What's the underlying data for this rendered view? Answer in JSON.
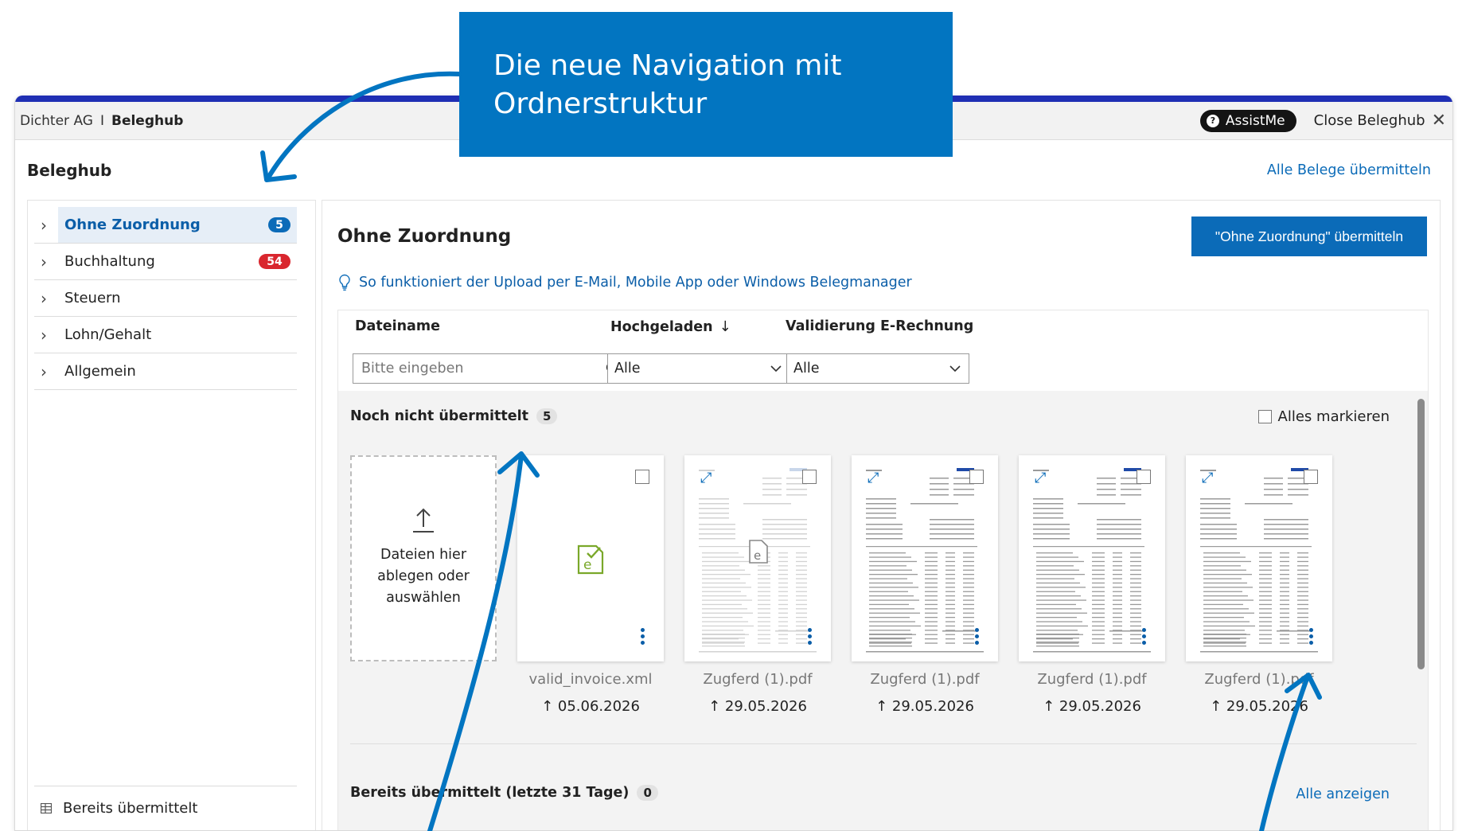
{
  "callout": {
    "line1": "Die neue Navigation mit",
    "line2": "Ordnerstruktur"
  },
  "titlebar": {
    "company": "Dichter AG",
    "separator": "I",
    "app": "Beleghub",
    "assist_label": "AssistMe",
    "close_label": "Close Beleghub"
  },
  "page": {
    "title": "Beleghub",
    "send_all_link": "Alle Belege übermitteln"
  },
  "sidebar": {
    "items": [
      {
        "label": "Ohne Zuordnung",
        "badge": "5",
        "active": true
      },
      {
        "label": "Buchhaltung",
        "badge": "54"
      },
      {
        "label": "Steuern"
      },
      {
        "label": "Lohn/Gehalt"
      },
      {
        "label": "Allgemein"
      }
    ],
    "footer_label": "Bereits übermittelt"
  },
  "main": {
    "title": "Ohne Zuordnung",
    "primary_button": "\"Ohne Zuordnung\" übermitteln",
    "info_link": "So funktioniert der Upload per E-Mail, Mobile App oder Windows Belegmanager",
    "columns": {
      "filename": "Dateiname",
      "uploaded": "Hochgeladen",
      "validation": "Validierung E-Rechnung"
    },
    "search_placeholder": "Bitte eingeben",
    "uploaded_filter": "Alle",
    "validation_filter": "Alle",
    "pending_section": {
      "title": "Noch nicht übermittelt",
      "count": "5",
      "select_all": "Alles markieren"
    },
    "dropzone": {
      "line1": "Dateien hier",
      "line2": "ablegen oder",
      "line3": "auswählen"
    },
    "files": [
      {
        "name": "valid_invoice.xml",
        "date": "05.06.2026"
      },
      {
        "name": "Zugferd (1).pdf",
        "date": "29.05.2026"
      },
      {
        "name": "Zugferd (1).pdf",
        "date": "29.05.2026"
      },
      {
        "name": "Zugferd (1).pdf",
        "date": "29.05.2026"
      },
      {
        "name": "Zugferd (1).pdf",
        "date": "29.05.2026"
      }
    ],
    "sent_section": {
      "title": "Bereits übermittelt (letzte 31 Tage)",
      "count": "0",
      "show_all": "Alle anzeigen"
    }
  },
  "colors": {
    "accent": "#0b6bb8",
    "callout": "#0275c1",
    "window_bar": "#1f2fb4",
    "badge_red": "#d9262e",
    "xml_icon": "#7aa82a"
  }
}
